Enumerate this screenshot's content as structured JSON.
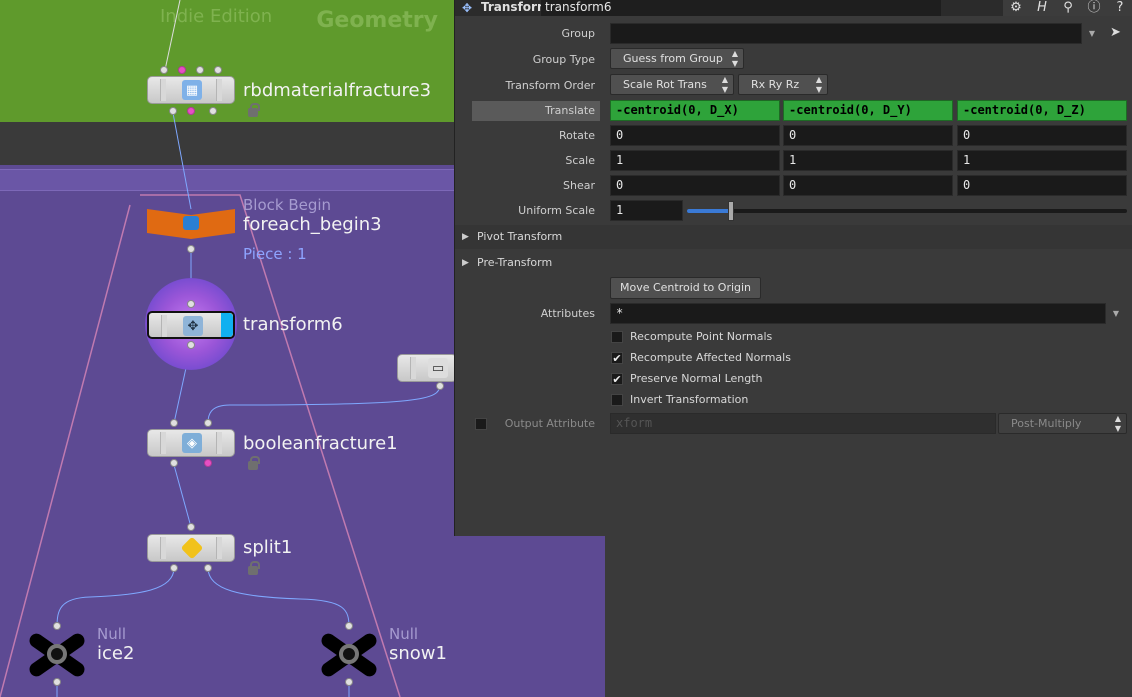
{
  "network": {
    "edition_watermark": "Indie Edition",
    "context_label": "Geometry",
    "nodes": {
      "rbd": {
        "name": "rbdmaterialfracture3"
      },
      "foreach": {
        "type": "Block Begin",
        "name": "foreach_begin3",
        "piece": "Piece : 1"
      },
      "transform": {
        "name": "transform6"
      },
      "boolean": {
        "name": "booleanfracture1"
      },
      "split": {
        "name": "split1"
      },
      "ice": {
        "type": "Null",
        "name": "ice2"
      },
      "snow": {
        "type": "Null",
        "name": "snow1"
      }
    }
  },
  "params": {
    "node_type": "Transform",
    "node_name": "transform6",
    "tools": [
      "gear-icon",
      "help-h-icon",
      "search-icon",
      "info-icon",
      "question-icon"
    ],
    "group": {
      "label": "Group",
      "value": ""
    },
    "group_type": {
      "label": "Group Type",
      "value": "Guess from Group"
    },
    "transform_order": {
      "label": "Transform Order",
      "order": "Scale Rot Trans",
      "rot": "Rx Ry Rz"
    },
    "translate": {
      "label": "Translate",
      "x": "-centroid(0, D_X)",
      "y": "-centroid(0, D_Y)",
      "z": "-centroid(0, D_Z)"
    },
    "rotate": {
      "label": "Rotate",
      "x": "0",
      "y": "0",
      "z": "0"
    },
    "scale": {
      "label": "Scale",
      "x": "1",
      "y": "1",
      "z": "1"
    },
    "shear": {
      "label": "Shear",
      "x": "0",
      "y": "0",
      "z": "0"
    },
    "uniform_scale": {
      "label": "Uniform Scale",
      "value": "1",
      "slider_fraction": 0.1
    },
    "folders": {
      "pivot": "Pivot Transform",
      "pre": "Pre-Transform"
    },
    "move_centroid": "Move Centroid to Origin",
    "attributes": {
      "label": "Attributes",
      "value": "*"
    },
    "checks": {
      "recompute_point": {
        "label": "Recompute Point Normals",
        "checked": false
      },
      "recompute_affected": {
        "label": "Recompute Affected Normals",
        "checked": true
      },
      "preserve_length": {
        "label": "Preserve Normal Length",
        "checked": true
      },
      "invert": {
        "label": "Invert Transformation",
        "checked": false
      }
    },
    "output_attribute": {
      "label": "Output Attribute",
      "placeholder": "xform",
      "mode": "Post-Multiply"
    }
  }
}
